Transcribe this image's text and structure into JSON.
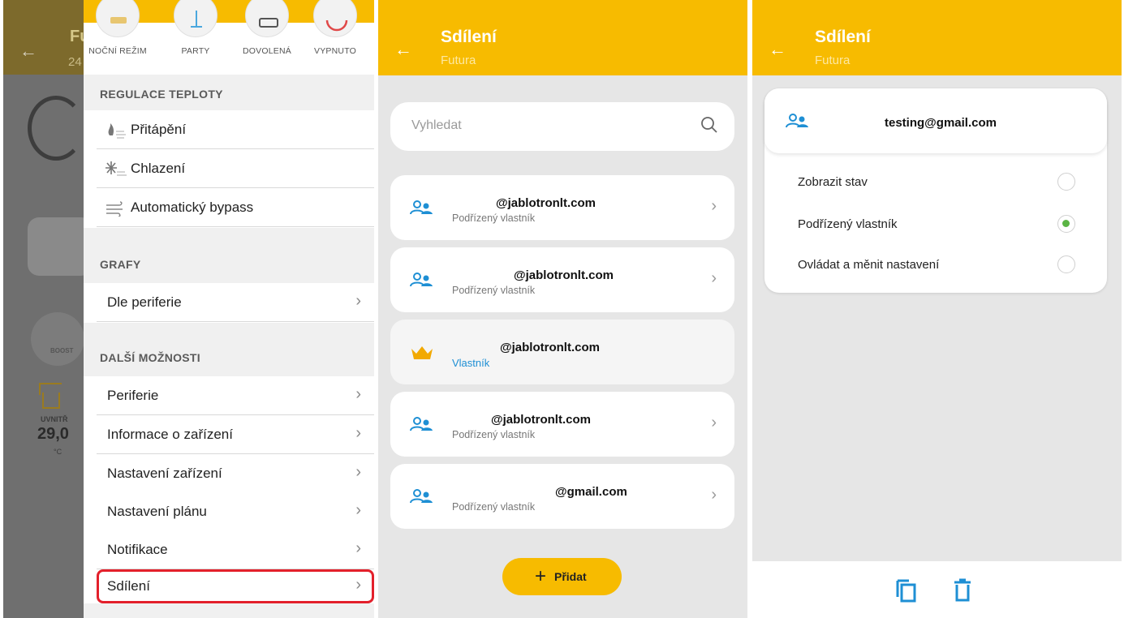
{
  "panel_left": {
    "background_app": {
      "title": "Fu",
      "subtitle": "24",
      "boost_label": "BOOST",
      "inside_label": "UVNITŘ",
      "inside_temp": "29,0",
      "temp_unit": "°C"
    },
    "modes": [
      {
        "label": "NOČNÍ REŽIM",
        "icon": "moon-mode-icon"
      },
      {
        "label": "PARTY",
        "icon": "party-icon"
      },
      {
        "label": "DOVOLENÁ",
        "icon": "suitcase-icon"
      },
      {
        "label": "VYPNUTO",
        "icon": "power-off-icon"
      }
    ],
    "sections": {
      "temperature": {
        "title": "REGULACE TEPLOTY",
        "items": [
          {
            "label": "Přitápění",
            "icon": "heating-icon"
          },
          {
            "label": "Chlazení",
            "icon": "cooling-icon"
          },
          {
            "label": "Automatický bypass",
            "icon": "bypass-icon"
          }
        ]
      },
      "graphs": {
        "title": "GRAFY",
        "items": [
          {
            "label": "Dle periferie"
          }
        ]
      },
      "more": {
        "title": "DALŠÍ MOŽNOSTI",
        "items": [
          {
            "label": "Periferie"
          },
          {
            "label": "Informace o zařízení"
          },
          {
            "label": "Nastavení zařízení"
          },
          {
            "label": "Nastavení plánu"
          },
          {
            "label": "Notifikace"
          },
          {
            "label": "Sdílení",
            "highlighted": true
          }
        ]
      }
    },
    "highlight_color": "#e3202b"
  },
  "panel_middle": {
    "header": {
      "title": "Sdílení",
      "subtitle": "Futura"
    },
    "search": {
      "placeholder": "Vyhledat"
    },
    "users": [
      {
        "email": "@jablotronlt.com",
        "role": "Podřízený vlastník",
        "icon": "user-group-icon"
      },
      {
        "email": "@jablotronlt.com",
        "role": "Podřízený vlastník",
        "icon": "user-group-icon"
      },
      {
        "email": "@jablotronlt.com",
        "role": "Vlastník",
        "icon": "crown-icon"
      },
      {
        "email": "@jablotronlt.com",
        "role": "Podřízený vlastník",
        "icon": "user-group-icon"
      },
      {
        "email": "@gmail.com",
        "role": "Podřízený vlastník",
        "icon": "user-group-icon"
      }
    ],
    "add_button": "Přidat"
  },
  "panel_right": {
    "header": {
      "title": "Sdílení",
      "subtitle": "Futura"
    },
    "user_email": "testing@gmail.com",
    "options": [
      {
        "label": "Zobrazit stav",
        "selected": false
      },
      {
        "label": "Podřízený vlastník",
        "selected": true
      },
      {
        "label": "Ovládat a měnit nastavení",
        "selected": false
      }
    ],
    "actions": [
      {
        "icon": "copy-icon"
      },
      {
        "icon": "delete-icon"
      }
    ]
  },
  "colors": {
    "brand_yellow": "#f7bb00",
    "icon_blue": "#1e8fd4",
    "radio_green": "#5bb544"
  }
}
